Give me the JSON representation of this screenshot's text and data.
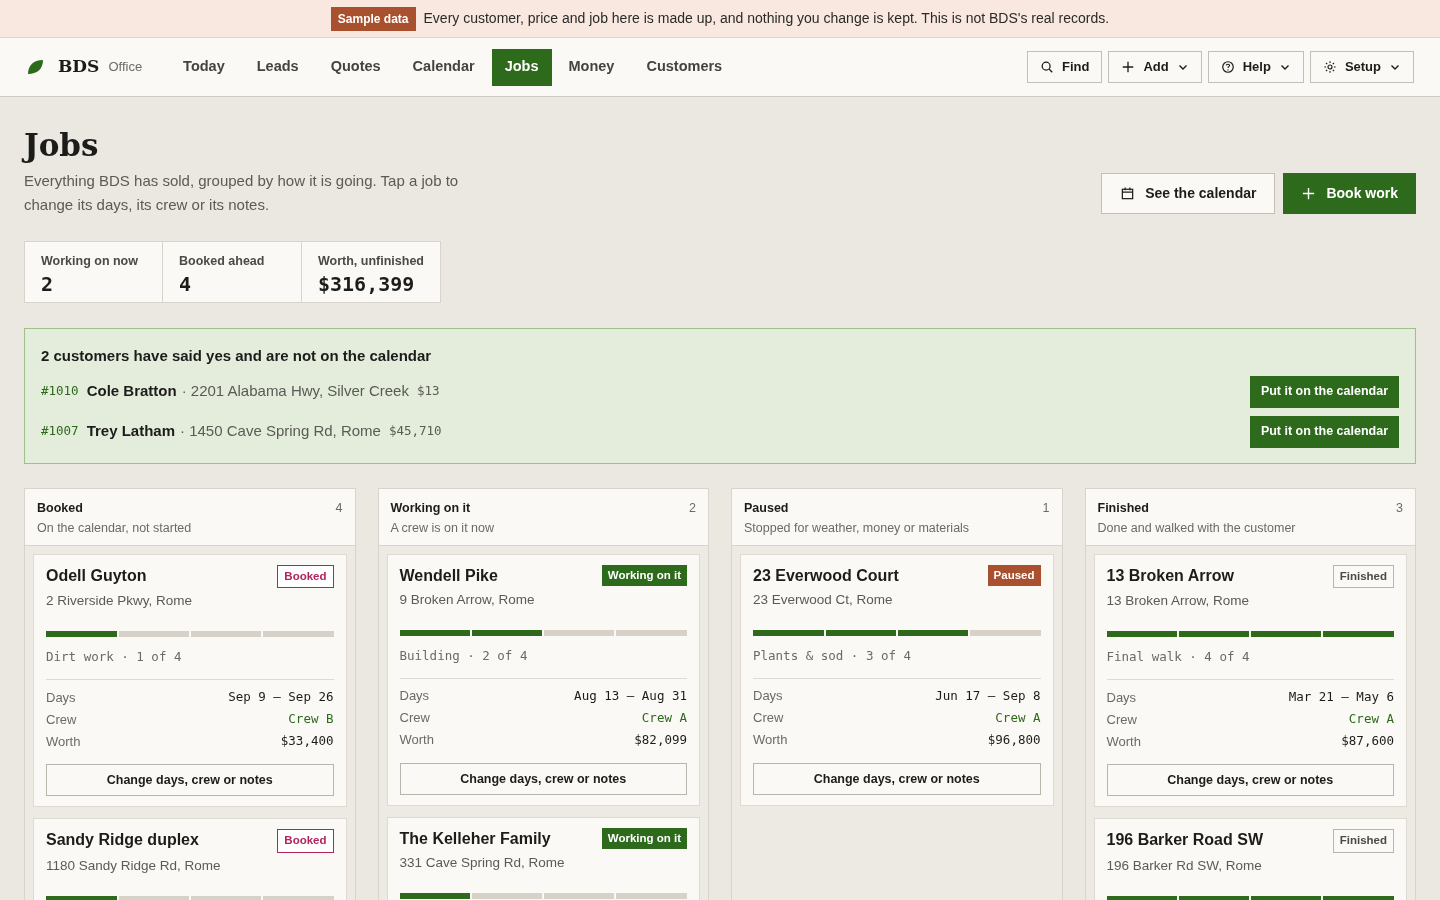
{
  "banner": {
    "badge": "Sample data",
    "text": "Every customer, price and job here is made up, and nothing you change is kept. This is not BDS's real records."
  },
  "brand": {
    "name": "BDS",
    "sub": "Office"
  },
  "nav": [
    {
      "label": "Today",
      "selected": false
    },
    {
      "label": "Leads",
      "selected": false
    },
    {
      "label": "Quotes",
      "selected": false
    },
    {
      "label": "Calendar",
      "selected": false
    },
    {
      "label": "Jobs",
      "selected": true
    },
    {
      "label": "Money",
      "selected": false
    },
    {
      "label": "Customers",
      "selected": false
    }
  ],
  "tools": [
    {
      "label": "Find",
      "kind": "search",
      "menu": false
    },
    {
      "label": "Add",
      "kind": "plus",
      "menu": true
    },
    {
      "label": "Help",
      "kind": "help",
      "menu": true
    },
    {
      "label": "Setup",
      "kind": "gear",
      "menu": true
    }
  ],
  "page": {
    "title": "Jobs",
    "intro": "Everything BDS has sold, grouped by how it is going. Tap a job to change its days, its crew or its notes.",
    "actions": [
      {
        "label": "See the calendar",
        "kind": "calendar"
      },
      {
        "label": "Book work",
        "kind": "plus"
      }
    ]
  },
  "stats": [
    {
      "label": "Working on now",
      "value": "2"
    },
    {
      "label": "Booked ahead",
      "value": "4"
    },
    {
      "label": "Worth, unfinished",
      "value": "$316,399"
    }
  ],
  "unscheduled": {
    "title": "2 customers have said yes and are not on the calendar",
    "items": [
      {
        "number": "#1010",
        "name": "Cole Bratton",
        "address": "· 2201 Alabama Hwy, Silver Creek",
        "amount": "$13",
        "button": "Put it on the calendar"
      },
      {
        "number": "#1007",
        "name": "Trey Latham",
        "address": "· 1450 Cave Spring Rd, Rome",
        "amount": "$45,710",
        "button": "Put it on the calendar"
      }
    ]
  },
  "columns": [
    {
      "title": "Booked",
      "subtitle": "On the calendar, not started",
      "count": "4",
      "kind": "booked",
      "jobs": [
        {
          "name": "Odell Guyton",
          "badge": "Booked",
          "address": "2 Riverside Pkwy, Rome",
          "level": 0.25,
          "stage": "Dirt work · 1 of 4",
          "details": [
            {
              "label": "Days",
              "value": "Sep 9 – Sep 26"
            },
            {
              "label": "Crew",
              "value": "Crew B",
              "kind": "crew"
            },
            {
              "label": "Worth",
              "value": "$33,400"
            }
          ],
          "button": "Change days, crew or notes"
        },
        {
          "name": "Sandy Ridge duplex",
          "badge": "Booked",
          "address": "1180 Sandy Ridge Rd, Rome",
          "level": 0.25
        }
      ]
    },
    {
      "title": "Working on it",
      "subtitle": "A crew is on it now",
      "count": "2",
      "kind": "working",
      "jobs": [
        {
          "name": "Wendell Pike",
          "badge": "Working on it",
          "address": "9 Broken Arrow, Rome",
          "level": 0.5,
          "stage": "Building · 2 of 4",
          "details": [
            {
              "label": "Days",
              "value": "Aug 13 – Aug 31"
            },
            {
              "label": "Crew",
              "value": "Crew A",
              "kind": "crew"
            },
            {
              "label": "Worth",
              "value": "$82,099"
            }
          ],
          "button": "Change days, crew or notes"
        },
        {
          "name": "The Kelleher Family",
          "badge": "Working on it",
          "address": "331 Cave Spring Rd, Rome",
          "level": 0.25
        }
      ]
    },
    {
      "title": "Paused",
      "subtitle": "Stopped for weather, money or materials",
      "count": "1",
      "kind": "paused",
      "jobs": [
        {
          "name": "23 Everwood Court",
          "badge": "Paused",
          "address": "23 Everwood Ct, Rome",
          "level": 0.75,
          "stage": "Plants & sod · 3 of 4",
          "details": [
            {
              "label": "Days",
              "value": "Jun 17 – Sep 8"
            },
            {
              "label": "Crew",
              "value": "Crew A",
              "kind": "crew"
            },
            {
              "label": "Worth",
              "value": "$96,800"
            }
          ],
          "button": "Change days, crew or notes"
        }
      ]
    },
    {
      "title": "Finished",
      "subtitle": "Done and walked with the customer",
      "count": "3",
      "kind": "finished",
      "jobs": [
        {
          "name": "13 Broken Arrow",
          "badge": "Finished",
          "address": "13 Broken Arrow, Rome",
          "level": 1,
          "stage": "Final walk · 4 of 4",
          "details": [
            {
              "label": "Days",
              "value": "Mar 21 – May 6"
            },
            {
              "label": "Crew",
              "value": "Crew A",
              "kind": "crew"
            },
            {
              "label": "Worth",
              "value": "$87,600"
            }
          ],
          "button": "Change days, crew or notes"
        },
        {
          "name": "196 Barker Road SW",
          "badge": "Finished",
          "address": "196 Barker Rd SW, Rome",
          "level": 1
        }
      ]
    }
  ]
}
